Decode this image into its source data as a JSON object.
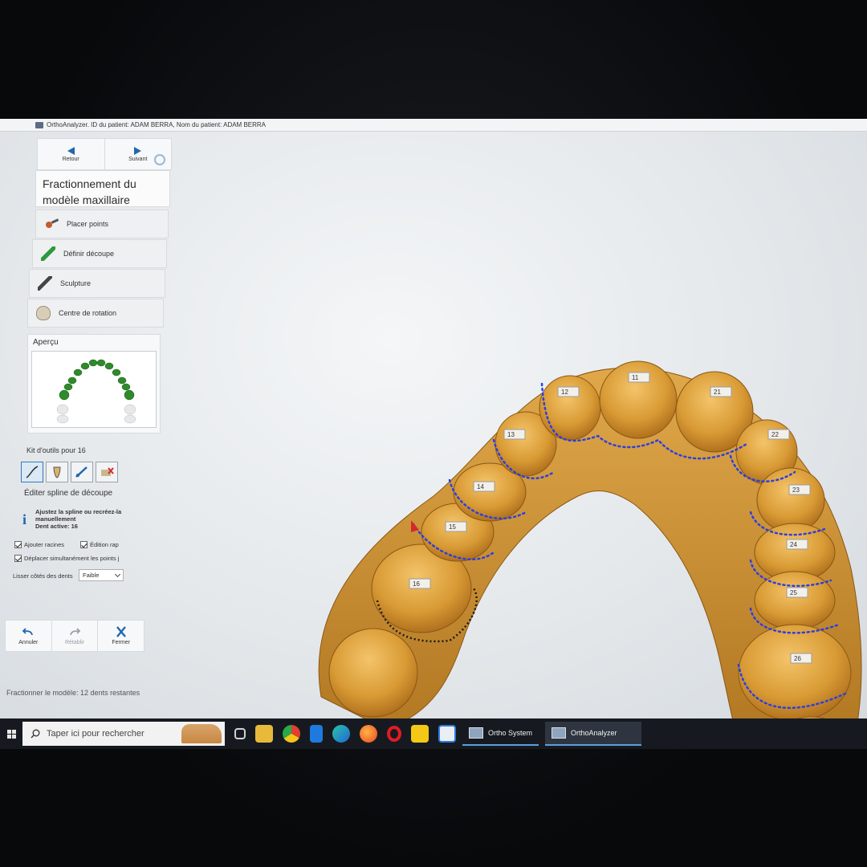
{
  "window": {
    "title": "OrthoAnalyzer. ID du patient: ADAM BERRA, Nom du patient: ADAM  BERRA"
  },
  "nav": {
    "back_label": "Retour",
    "next_label": "Suivant"
  },
  "workflow": {
    "title_line1": "Fractionnement du",
    "title_line2": "modèle maxillaire",
    "steps": [
      {
        "label": "Placer points",
        "icon": "place-points-icon"
      },
      {
        "label": "Définir découpe",
        "icon": "cut-icon"
      },
      {
        "label": "Sculpture",
        "icon": "sculpt-icon"
      },
      {
        "label": "Centre de rotation",
        "icon": "rotation-icon"
      }
    ]
  },
  "preview": {
    "label": "Aperçu"
  },
  "toolkit": {
    "label": "Kit d'outils pour 16",
    "tools": [
      "spline-edit-icon",
      "root-icon",
      "move-points-icon",
      "delete-icon"
    ],
    "active_index": 0
  },
  "spline": {
    "heading": "Éditer spline de découpe",
    "info_line1": "Ajustez la spline ou recréez-la",
    "info_line2": "manuellement",
    "info_line3": "Dent active: 16",
    "options": [
      {
        "label": "Ajouter racines",
        "checked": true
      },
      {
        "label": "Édition rap",
        "checked": true
      },
      {
        "label": "Déplacer simultanément les points j",
        "checked": true
      }
    ],
    "smooth_label": "Lisser côtés des dents",
    "smooth_value": "Faible"
  },
  "actions": {
    "undo_label": "Annuler",
    "redo_label": "Rétablir",
    "close_label": "Fermer"
  },
  "status": {
    "text": "Fractionner le modèle: 12 dents restantes"
  },
  "teeth": [
    "11",
    "12",
    "21",
    "13",
    "22",
    "14",
    "23",
    "15",
    "24",
    "16",
    "25",
    "26"
  ],
  "taskbar": {
    "search_placeholder": "Taper ici pour rechercher",
    "apps": [
      {
        "label": "Ortho System",
        "active": false
      },
      {
        "label": "OrthoAnalyzer",
        "active": true
      }
    ],
    "pinned": [
      "task-view-icon",
      "file-explorer-icon",
      "chrome-icon",
      "app-icon",
      "edge-icon",
      "firefox-icon",
      "opera-icon",
      "notes-app-icon",
      "remote-app-icon"
    ],
    "colors": {
      "accent": "#5c9ee0",
      "tooth_gold": "#d69a34",
      "spline_blue": "#2b3fe0",
      "preview_green": "#2f8a2a"
    }
  }
}
